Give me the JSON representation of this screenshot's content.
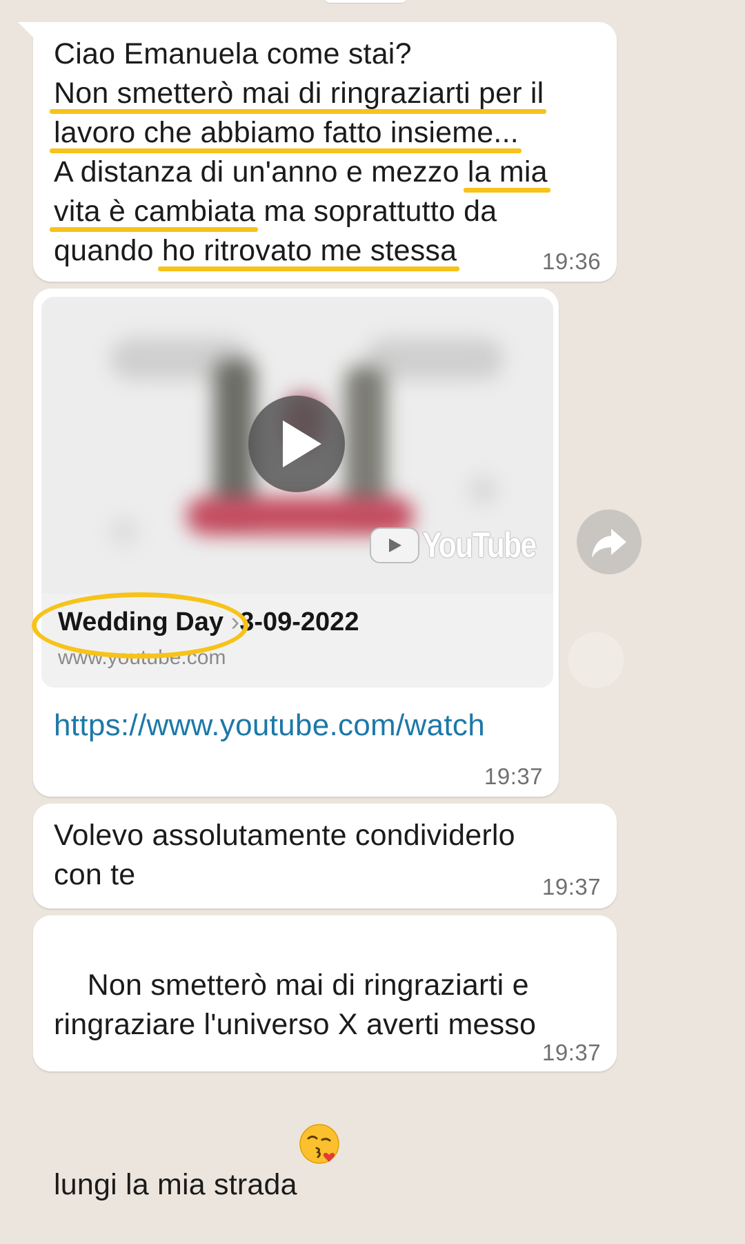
{
  "messages": [
    {
      "id": "m1",
      "segments": [
        {
          "text": "Ciao Emanuela come stai?\n",
          "highlight": false
        },
        {
          "text": "Non smetterò mai di ringraziarti per il",
          "highlight": true
        },
        {
          "text": "\n",
          "highlight": false
        },
        {
          "text": "lavoro che abbiamo fatto insieme...",
          "highlight": true
        },
        {
          "text": "\nA distanza di un'anno e mezzo ",
          "highlight": false
        },
        {
          "text": "la mia",
          "highlight": true
        },
        {
          "text": "\n",
          "highlight": false
        },
        {
          "text": "vita è cambiata",
          "highlight": true
        },
        {
          "text": " ma soprattutto da\nquando ",
          "highlight": false
        },
        {
          "text": "ho ritrovato me stessa",
          "highlight": true
        }
      ],
      "time": "19:36"
    },
    {
      "id": "m2",
      "link_preview": {
        "title": "Wedding Day ",
        "title_obscured": "3-09-2022",
        "domain": "www.youtube.com",
        "provider_logo_text": "YouTube"
      },
      "url": "https://www.youtube.com/watch",
      "time": "19:37"
    },
    {
      "id": "m3",
      "text": "Volevo assolutamente condividerlo\ncon te",
      "time": "19:37"
    },
    {
      "id": "m4",
      "text": "Non smetterò mai di ringraziarti e\nringraziare l'universo X averti messo\nlungi la mia strada",
      "emoji": "face-throwing-kiss-emoji",
      "time": "19:37"
    }
  ],
  "icons": {
    "play": "play-icon",
    "forward": "forward-icon",
    "youtube": "youtube-logo-icon"
  },
  "colors": {
    "background": "#ece5dd",
    "bubble": "#ffffff",
    "highlight": "#f7c31a",
    "link": "#1c78a8",
    "timestamp": "#6f6f6f"
  }
}
